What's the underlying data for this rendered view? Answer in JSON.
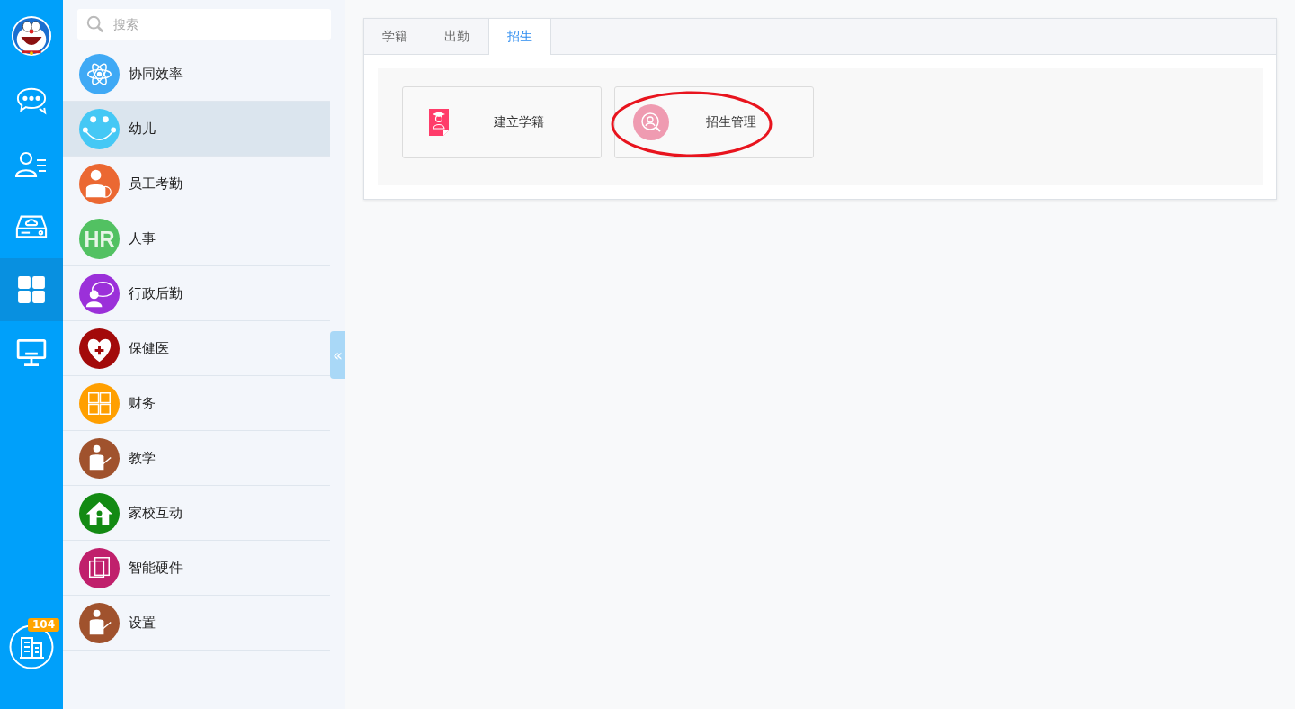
{
  "rail": {
    "items": [
      {
        "kind": "chat",
        "selected": false
      },
      {
        "kind": "contacts",
        "selected": false
      },
      {
        "kind": "drive",
        "selected": false
      },
      {
        "kind": "apps",
        "selected": true
      },
      {
        "kind": "monitor",
        "selected": false
      }
    ],
    "badge": "104"
  },
  "search": {
    "placeholder": "搜索"
  },
  "menu": [
    {
      "label": "协同效率",
      "kind": "atom",
      "color": "#3fa9f5",
      "selected": false
    },
    {
      "label": "幼儿",
      "kind": "face",
      "color": "#45c8f5",
      "selected": true
    },
    {
      "label": "员工考勤",
      "kind": "person",
      "color": "#eb6832",
      "selected": false
    },
    {
      "label": "人事",
      "kind": "text",
      "icon_text": "HR",
      "color": "#52c162",
      "selected": false
    },
    {
      "label": "行政后勤",
      "kind": "speaker",
      "color": "#9b30d9",
      "selected": false
    },
    {
      "label": "保健医",
      "kind": "heart",
      "color": "#a30a0a",
      "selected": false
    },
    {
      "label": "财务",
      "kind": "calc",
      "color": "#ff9f00",
      "selected": false
    },
    {
      "label": "教学",
      "kind": "teacher",
      "color": "#a0522d",
      "selected": false
    },
    {
      "label": "家校互动",
      "kind": "house",
      "color": "#138a13",
      "selected": false
    },
    {
      "label": "智能硬件",
      "kind": "tablet",
      "color": "#c0206c",
      "selected": false
    },
    {
      "label": "设置",
      "kind": "teacher",
      "color": "#a0522d",
      "selected": false
    }
  ],
  "collapse": "«",
  "tabs": [
    {
      "label": "学籍",
      "selected": false
    },
    {
      "label": "出勤",
      "selected": false
    },
    {
      "label": "招生",
      "selected": true
    }
  ],
  "cards": [
    {
      "label": "建立学籍",
      "kind": "file"
    },
    {
      "label": "招生管理",
      "kind": "search-person"
    }
  ]
}
